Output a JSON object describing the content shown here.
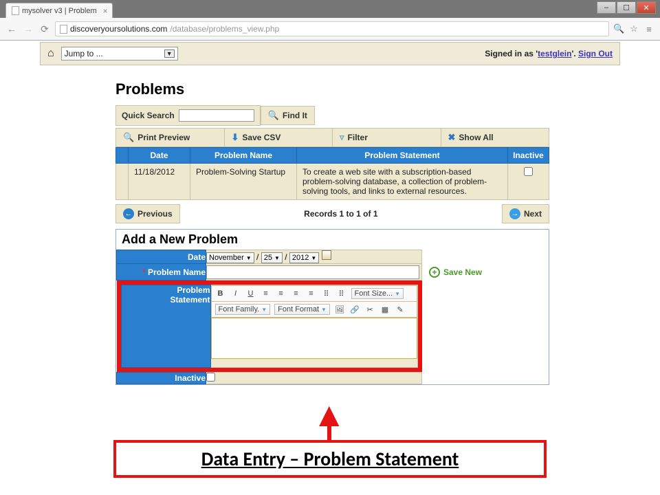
{
  "browser": {
    "tab_title": "mysolver v3 | Problem",
    "url_host": "discoveryoursolutions.com",
    "url_path": "/database/problems_view.php"
  },
  "navbar": {
    "jump_label": "Jump to ...",
    "signed_prefix": "Signed in as '",
    "username": "testglein",
    "signed_suffix": "'. ",
    "signout": "Sign Out"
  },
  "page": {
    "title": "Problems",
    "quick_search_label": "Quick Search",
    "find_it": "Find It",
    "toolbar": {
      "print_preview": "Print Preview",
      "save_csv": "Save CSV",
      "filter": "Filter",
      "show_all": "Show All"
    },
    "table": {
      "headers": {
        "date": "Date",
        "name": "Problem Name",
        "statement": "Problem Statement",
        "inactive": "Inactive"
      },
      "rows": [
        {
          "date": "11/18/2012",
          "name": "Problem-Solving Startup",
          "statement": "To create a web site with a subscription-based problem-solving database, a collection of problem-solving tools, and links to external resources."
        }
      ]
    },
    "paging": {
      "prev": "Previous",
      "next": "Next",
      "records": "Records 1 to 1 of 1"
    },
    "form": {
      "heading": "Add a New Problem",
      "labels": {
        "date": "Date",
        "problem_name": "Problem Name",
        "problem_statement": "Problem\nStatement",
        "inactive": "Inactive"
      },
      "date_parts": {
        "month": "November",
        "sep": "/",
        "day": "25",
        "year": "2012"
      },
      "save_new": "Save New",
      "editor": {
        "font_size": "Font Size...",
        "font_family": "Font Family.",
        "font_format": "Font Format"
      }
    }
  },
  "annotation": {
    "caption": "Data Entry – Problem Statement"
  }
}
